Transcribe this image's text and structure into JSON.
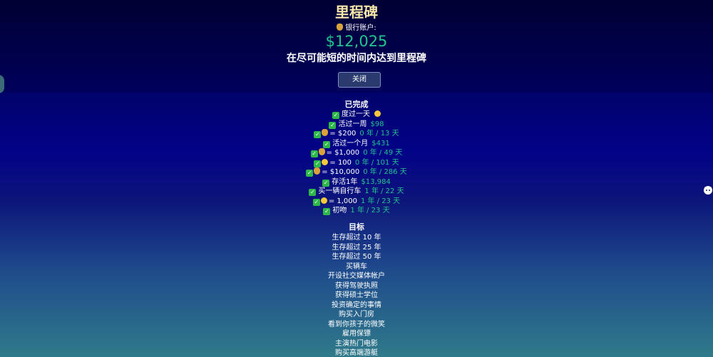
{
  "header": {
    "title": "里程碑",
    "bank_label": "银行账户:",
    "bank_amount": "$12,025",
    "subtitle": "在尽可能短的时间内达到里程碑",
    "close_label": "关闭"
  },
  "completed": {
    "heading": "已完成",
    "items": [
      {
        "icon": "check",
        "extra": "",
        "label": "度过一天",
        "emoji": "face",
        "value": ""
      },
      {
        "icon": "check",
        "extra": "",
        "label": "活过一周",
        "emoji": "",
        "value": "$98"
      },
      {
        "icon": "check",
        "extra": "money-bag",
        "label": "= $200",
        "emoji": "",
        "value": "0 年 / 13 天"
      },
      {
        "icon": "check",
        "extra": "",
        "label": "活过一个月",
        "emoji": "",
        "value": "$431"
      },
      {
        "icon": "check",
        "extra": "money-bag",
        "label": "= $1,000",
        "emoji": "",
        "value": "0 年 / 49 天"
      },
      {
        "icon": "check",
        "extra": "face",
        "label": "= 100",
        "emoji": "",
        "value": "0 年 / 101 天"
      },
      {
        "icon": "check",
        "extra": "money-bag",
        "label": "= $10,000",
        "emoji": "",
        "value": "0 年 / 286 天"
      },
      {
        "icon": "check",
        "extra": "",
        "label": "存活1年",
        "emoji": "",
        "value": "$13,984"
      },
      {
        "icon": "check",
        "extra": "",
        "label": "买一辆自行车",
        "emoji": "",
        "value": "1 年 / 22 天"
      },
      {
        "icon": "check",
        "extra": "face",
        "label": "= 1,000",
        "emoji": "",
        "value": "1 年 / 23 天"
      },
      {
        "icon": "check",
        "extra": "",
        "label": "初吻",
        "emoji": "",
        "value": "1 年 / 23 天"
      }
    ]
  },
  "goals": {
    "heading": "目标",
    "items": [
      "生存超过 10 年",
      "生存超过 25 年",
      "生存超过 50 年",
      "买辆车",
      "开设社交媒体帐户",
      "获得驾驶执照",
      "获得硕士学位",
      "投资确定的事情",
      "购买入门房",
      "看到你孩子的微笑",
      "雇用保镖",
      "主演热门电影",
      "购买高端游艇"
    ]
  },
  "colors": {
    "accent_green": "#23c48f",
    "title_gold": "#f6e6a8",
    "check_green": "#2fb84a"
  },
  "icons": {
    "bank": "money-bag-icon",
    "check": "check-mark-icon",
    "github": "github-octocat-icon"
  }
}
